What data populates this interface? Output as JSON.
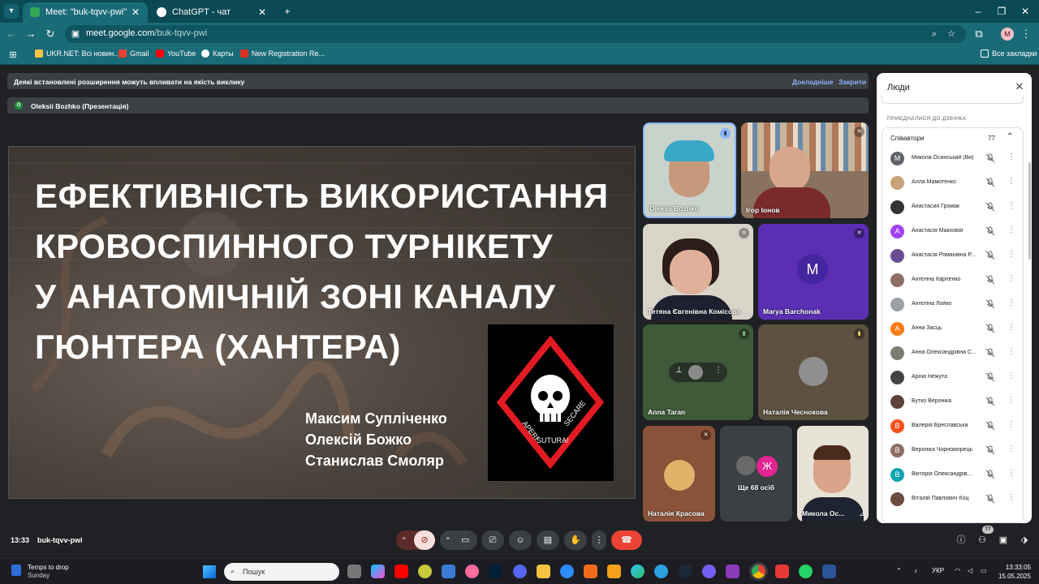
{
  "browser": {
    "tabs": [
      {
        "title": "Meet: \"buk-tqvv-pwi\"",
        "active": true
      },
      {
        "title": "ChatGPT - чат",
        "active": false
      }
    ],
    "new_tab": "+",
    "url_host": "meet.google.com",
    "url_path": "/buk-tqvv-pwi",
    "profile_initial": "M",
    "bookmarks": [
      "UKR.NET: Всі новин...",
      "Gmail",
      "YouTube",
      "Карты",
      "New Registration Re..."
    ],
    "all_bookmarks": "Все закладки"
  },
  "meet": {
    "banner_text": "Деякі встановлені розширення можуть впливати на якість виклику",
    "banner_details": "Докладніше",
    "banner_close": "Закрити",
    "presenter_initial": "O",
    "presenter_text": "Oleksii Bozhko (Презентація)",
    "slide": {
      "title_lines": [
        "ЕФЕКТИВНІСТЬ ВИКОРИСТАННЯ",
        "КРОВОСПИННОГО ТУРНІКЕТУ",
        "У АНАТОМІЧНІЙ ЗОНІ КАНАЛУ",
        "ГЮНТЕРА (ХАНТЕРА)"
      ],
      "authors": [
        "Максим Супліченко",
        "Олексій Божко",
        "Станислав Смоляр"
      ],
      "logo_left": "APERI",
      "logo_right": "SECARE",
      "logo_bottom": "SUTURA!"
    },
    "tiles": {
      "t1": "Oleksii Bozhko",
      "t2": "Ігор Іонов",
      "t3": "Тетяна Євгенівна Комісова",
      "t4": "Marya Barchonak",
      "t4_initial": "M",
      "t5": "Anna Taran",
      "t6": "Наталія Чеснокова",
      "t7": "Наталія Красова",
      "t8": "Ще 68 осіб",
      "t8_initial": "Ж",
      "t9": "Микола Ос..."
    },
    "people": {
      "title": "Люди",
      "section": "ПРИЄДНАЛИСЯ ДО ДЗВІНКА",
      "group": "Співавтори",
      "count": "77",
      "list": [
        {
          "initial": "М",
          "name": "Микола Осинський (Ви)",
          "color": "#5f6368"
        },
        {
          "initial": "",
          "name": "Алла Мамотенко",
          "color": "#c9a27a"
        },
        {
          "initial": "",
          "name": "Анастасия Громак",
          "color": "#333333"
        },
        {
          "initial": "А",
          "name": "Анастасія Макховій",
          "color": "#a142f4"
        },
        {
          "initial": "",
          "name": "Анастасія Романівна Р...",
          "color": "#6a4c93"
        },
        {
          "initial": "",
          "name": "Ангеліна Карпенко",
          "color": "#8d6e63"
        },
        {
          "initial": "",
          "name": "Ангеліна Лойко",
          "color": "#9aa0a6"
        },
        {
          "initial": "А",
          "name": "Анна Засць",
          "color": "#fa7b17"
        },
        {
          "initial": "",
          "name": "Анна Олександрівна С...",
          "color": "#7a7f72"
        },
        {
          "initial": "",
          "name": "Аріна Нежута",
          "color": "#444444"
        },
        {
          "initial": "",
          "name": "Бутко Вероніка",
          "color": "#5d4037"
        },
        {
          "initial": "В",
          "name": "Валерія Бреславська",
          "color": "#f4511e"
        },
        {
          "initial": "В",
          "name": "Вероніка Чорноморець",
          "color": "#8d6e63"
        },
        {
          "initial": "В",
          "name": "Вікторія Олександрів...",
          "color": "#12a4af"
        },
        {
          "initial": "",
          "name": "Віталій Павлович Коц",
          "color": "#6d4c41"
        }
      ]
    },
    "callbar": {
      "time": "13:33",
      "code": "buk-tqvv-pwi",
      "people_badge": "77"
    }
  },
  "taskbar": {
    "weather_title": "Temps to drop",
    "weather_sub": "Sunday",
    "search": "Пошук",
    "lang": "УКР",
    "time": "13:33:05",
    "date": "15.05.2025"
  },
  "colors": {
    "chrome_teal": "#1a6b78",
    "meet_bg": "#202124",
    "end_call": "#ea4335",
    "mic_off": "#f9dedc"
  }
}
